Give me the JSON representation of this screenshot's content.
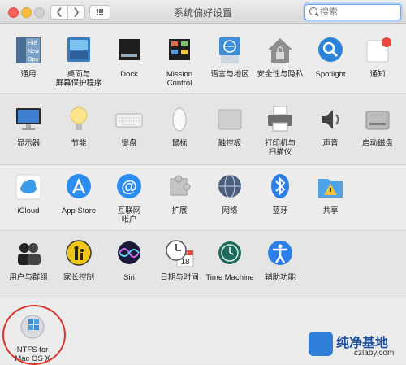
{
  "window": {
    "title": "系统偏好设置",
    "search_placeholder": "搜索"
  },
  "rows": [
    [
      "通用",
      "桌面与\n屏幕保护程序",
      "Dock",
      "Mission\nControl",
      "语言与地区",
      "安全性与隐私",
      "Spotlight",
      "通知"
    ],
    [
      "显示器",
      "节能",
      "键盘",
      "鼠标",
      "触控板",
      "打印机与\n扫描仪",
      "声音",
      "启动磁盘"
    ],
    [
      "iCloud",
      "App Store",
      "互联网\n帐户",
      "扩展",
      "网络",
      "蓝牙",
      "共享"
    ],
    [
      "用户与群组",
      "家长控制",
      "Siri",
      "日期与时间",
      "Time Machine",
      "辅助功能"
    ]
  ],
  "file_icon_text": [
    "File",
    "New",
    "Ope"
  ],
  "calendar": {
    "month": "JUL",
    "day": "18"
  },
  "third_party": {
    "label": "NTFS for\nMac OS X"
  },
  "watermark": {
    "title": "纯净基地",
    "url": "czlaby.com"
  },
  "colors": {
    "accent": "#1c7cf4",
    "highlight_ring": "#d9342b"
  }
}
